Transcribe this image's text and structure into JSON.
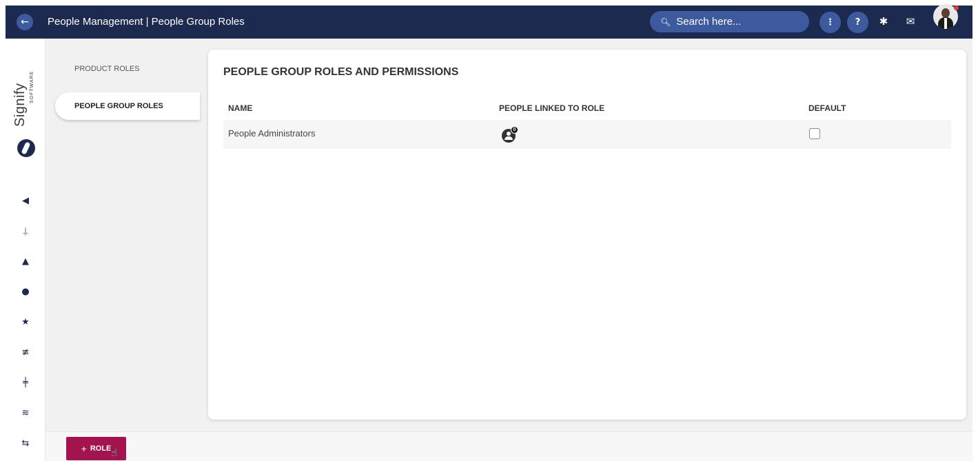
{
  "header": {
    "back_icon": "arrow-left-icon",
    "title": "People Management | People Group Roles",
    "search_placeholder": "Search here...",
    "search_icon": "search-icon",
    "menu_icon_glyph": "⋮",
    "help_glyph": "?",
    "settings_glyph": "✱",
    "messages_glyph": "✉"
  },
  "logo": {
    "word": "Signify",
    "sub": "SOFTWARE"
  },
  "rail_icons": [
    {
      "name": "megaphone-icon",
      "glyph": "◀"
    },
    {
      "name": "user-upload-icon",
      "glyph": "⍊"
    },
    {
      "name": "graduation-cap-icon",
      "glyph": "▲"
    },
    {
      "name": "gauge-icon",
      "glyph": "●"
    },
    {
      "name": "star-icon",
      "glyph": "★"
    },
    {
      "name": "sliders-icon",
      "glyph": "≢"
    },
    {
      "name": "signpost-icon",
      "glyph": "╪"
    },
    {
      "name": "handshake-icon",
      "glyph": "≋"
    },
    {
      "name": "people-arrows-icon",
      "glyph": "⇆"
    },
    {
      "name": "scales-icon",
      "glyph": "⚖"
    }
  ],
  "subnav": {
    "items": [
      {
        "label": "PRODUCT ROLES"
      },
      {
        "label": "PEOPLE GROUP ROLES"
      }
    ]
  },
  "panel": {
    "title": "PEOPLE GROUP ROLES AND PERMISSIONS",
    "columns": [
      "NAME",
      "PEOPLE LINKED TO ROLE",
      "DEFAULT"
    ],
    "rows": [
      {
        "name": "People Administrators",
        "people_count": "0",
        "default": false
      }
    ]
  },
  "footer": {
    "add_role_plus": "+",
    "add_role_label": "ROLE"
  },
  "colors": {
    "topbar": "#1b2a4e",
    "accent": "#3d5a9f",
    "add_button": "#a3144f"
  }
}
